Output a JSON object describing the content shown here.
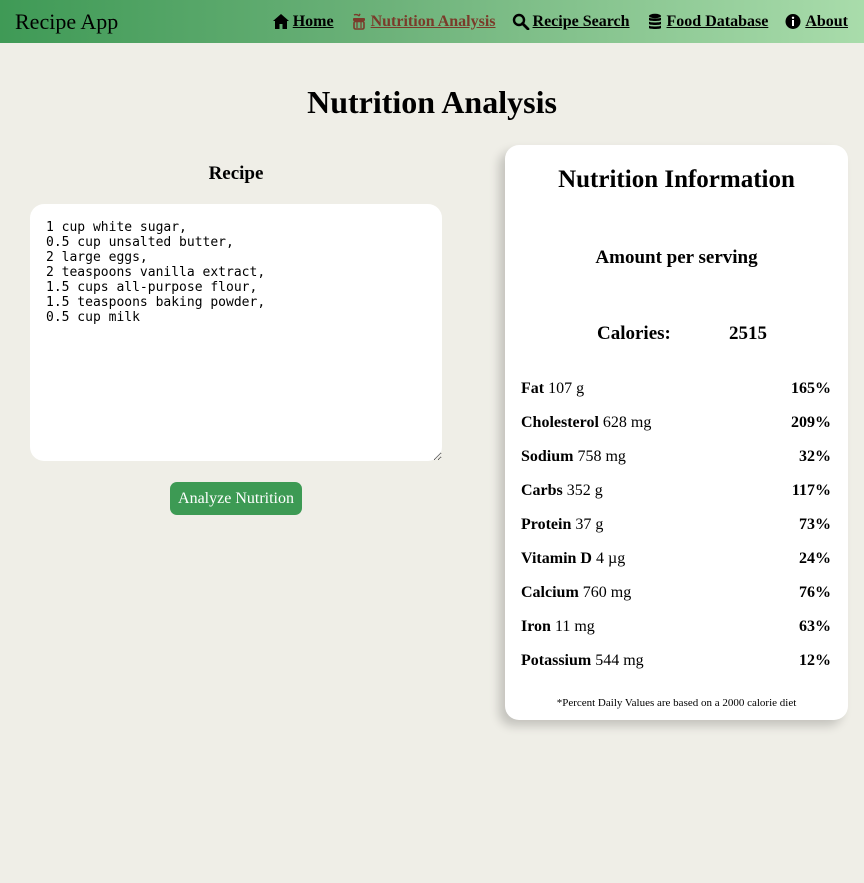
{
  "navbar": {
    "brand": "Recipe App",
    "links": [
      {
        "label": "Home",
        "icon": "home-icon"
      },
      {
        "label": "Nutrition Analysis",
        "icon": "apple-icon",
        "active": true
      },
      {
        "label": "Recipe Search",
        "icon": "search-icon"
      },
      {
        "label": "Food Database",
        "icon": "database-icon"
      },
      {
        "label": "About",
        "icon": "info-icon"
      }
    ]
  },
  "page": {
    "title": "Nutrition Analysis"
  },
  "recipe": {
    "heading": "Recipe",
    "text": "1 cup white sugar,\n0.5 cup unsalted butter,\n2 large eggs,\n2 teaspoons vanilla extract,\n1.5 cups all-purpose flour,\n1.5 teaspoons baking powder,\n0.5 cup milk",
    "button_label": "Analyze Nutrition"
  },
  "nutrition": {
    "title": "Nutrition Information",
    "serving_label": "Amount per serving",
    "calories_label": "Calories:",
    "calories_value": "2515",
    "nutrients": [
      {
        "name": "Fat",
        "amount": "107 g",
        "pct": "165%"
      },
      {
        "name": "Cholesterol",
        "amount": "628 mg",
        "pct": "209%"
      },
      {
        "name": "Sodium",
        "amount": "758 mg",
        "pct": "32%"
      },
      {
        "name": "Carbs",
        "amount": "352 g",
        "pct": "117%"
      },
      {
        "name": "Protein",
        "amount": "37 g",
        "pct": "73%"
      },
      {
        "name": "Vitamin D",
        "amount": "4 µg",
        "pct": "24%"
      },
      {
        "name": "Calcium",
        "amount": "760 mg",
        "pct": "76%"
      },
      {
        "name": "Iron",
        "amount": "11 mg",
        "pct": "63%"
      },
      {
        "name": "Potassium",
        "amount": "544 mg",
        "pct": "12%"
      }
    ],
    "footnote": "*Percent Daily Values are based on a 2000 calorie diet"
  },
  "colors": {
    "nav_gradient_start": "#3f9a56",
    "nav_gradient_end": "#a9dcab",
    "active_link": "#7a3b2a",
    "button": "#3d9a54",
    "background": "#efeee7"
  }
}
